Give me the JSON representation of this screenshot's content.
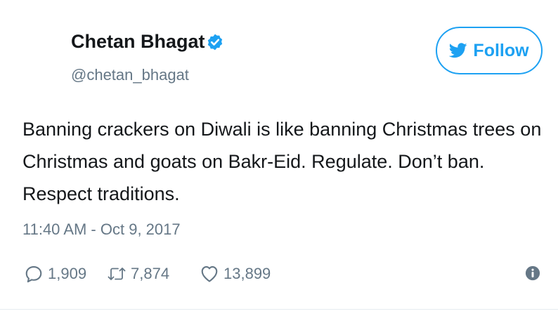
{
  "user": {
    "display_name": "Chetan Bhagat",
    "handle": "@chetan_bhagat",
    "verified": true,
    "verified_icon": "verified-badge-icon"
  },
  "follow_button": {
    "label": "Follow",
    "icon": "twitter-bird-icon"
  },
  "tweet": {
    "text": "Banning crackers on Diwali is like banning Christmas trees on Christmas and goats on Bakr-Eid. Regulate. Don’t ban. Respect traditions.",
    "timestamp": "11:40 AM - Oct 9, 2017"
  },
  "actions": {
    "reply": {
      "icon": "reply-icon",
      "count": "1,909"
    },
    "retweet": {
      "icon": "retweet-icon",
      "count": "7,874"
    },
    "like": {
      "icon": "heart-icon",
      "count": "13,899"
    },
    "info": {
      "icon": "info-icon"
    }
  },
  "colors": {
    "accent": "#1da1f2",
    "text_primary": "#14171a",
    "text_secondary": "#657786"
  }
}
